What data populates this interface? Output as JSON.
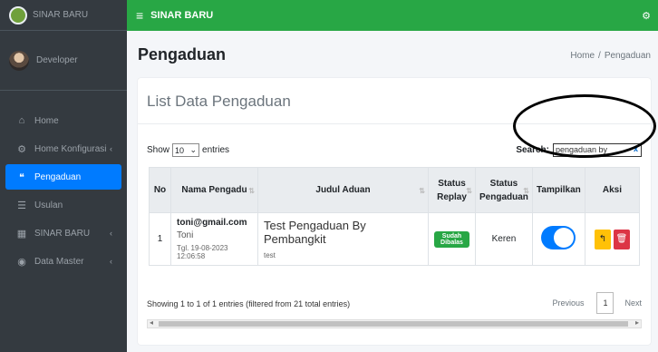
{
  "app": {
    "brand": "SINAR BARU",
    "topbar_title": "SINAR BARU"
  },
  "user": {
    "name": "Developer"
  },
  "sidebar": {
    "items": [
      {
        "label": "Home",
        "icon": "home-icon",
        "active": false,
        "caret": ""
      },
      {
        "label": "Home Konfigurasi",
        "icon": "cogs-icon",
        "active": false,
        "caret": "‹"
      },
      {
        "label": "Pengaduan",
        "icon": "quote-icon",
        "active": true,
        "caret": ""
      },
      {
        "label": "Usulan",
        "icon": "list-icon",
        "active": false,
        "caret": ""
      },
      {
        "label": "SINAR BARU",
        "icon": "building-icon",
        "active": false,
        "caret": "‹"
      },
      {
        "label": "Data Master",
        "icon": "database-icon",
        "active": false,
        "caret": "‹"
      }
    ]
  },
  "page": {
    "title": "Pengaduan",
    "breadcrumb": {
      "home": "Home",
      "sep": "/",
      "current": "Pengaduan"
    }
  },
  "card": {
    "title": "List Data Pengaduan"
  },
  "controls": {
    "show_label": "Show",
    "entries_value": "10",
    "entries_label": "entries",
    "search_label": "Search:",
    "search_value": "pengaduan by"
  },
  "table": {
    "headers": [
      "No",
      "Nama Pengadu",
      "Judul Aduan",
      "Status Replay",
      "Status Pengaduan",
      "Tampilkan",
      "Aksi"
    ],
    "rows": [
      {
        "no": "1",
        "email": "toni@gmail.com",
        "name": "Toni",
        "date": "Tgl. 19-08-2023 12:06:58",
        "judul": "Test Pengaduan By Pembangkit",
        "detail": "test",
        "status_replay": "Sudah Dibalas",
        "status_pengaduan": "Keren",
        "tampilkan": true
      }
    ]
  },
  "footer": {
    "info": "Showing 1 to 1 of 1 entries (filtered from 21 total entries)",
    "previous": "Previous",
    "page": "1",
    "next": "Next"
  },
  "colors": {
    "topbar": "#28a745",
    "active": "#007bff",
    "sidebar": "#343a40",
    "badge": "#28a745",
    "warn": "#ffc107",
    "danger": "#dc3545"
  }
}
